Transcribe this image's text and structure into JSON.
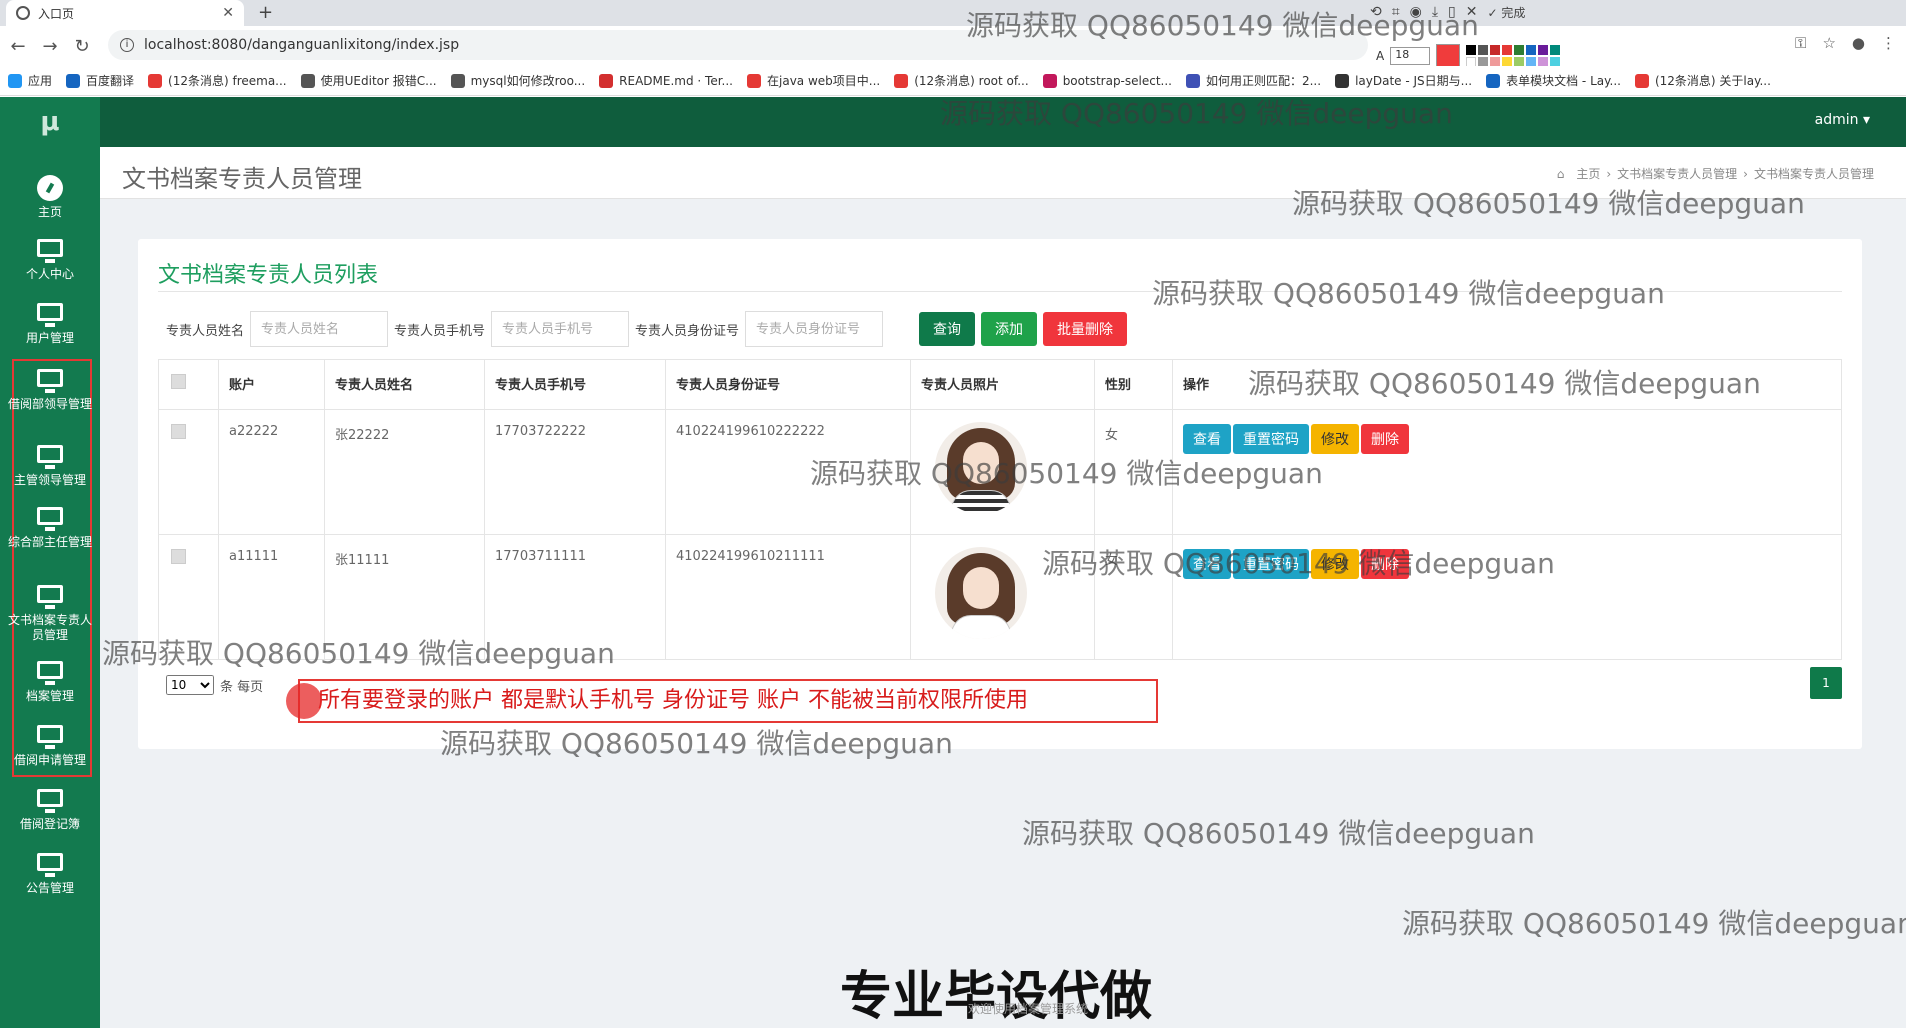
{
  "browser": {
    "tab_title": "入口页",
    "url": "localhost:8080/danganguanlixitong/index.jsp",
    "font_size": "18",
    "done_label": "完成",
    "bookmarks": [
      "应用",
      "百度翻译",
      "(12条消息) freema...",
      "使用UEditor 报错C...",
      "mysql如何修改roo...",
      "README.md · Ter...",
      "在java web项目中...",
      "(12条消息) root of...",
      "bootstrap-select...",
      "如何用正则匹配：2...",
      "layDate - JS日期与...",
      "表单模块文档 - Lay...",
      "(12条消息) 关于lay..."
    ]
  },
  "app": {
    "logo": "μ",
    "user": "admin",
    "sidebar": [
      "主页",
      "个人中心",
      "用户管理",
      "借阅部领导管理",
      "主管领导管理",
      "综合部主任管理",
      "文书档案专责人员管理",
      "档案管理",
      "借阅申请管理",
      "借阅登记簿",
      "公告管理"
    ]
  },
  "page": {
    "title": "文书档案专责人员管理",
    "breadcrumb": [
      "主页",
      "文书档案专责人员管理",
      "文书档案专责人员管理"
    ],
    "list_title": "文书档案专责人员列表"
  },
  "search": {
    "name_label": "专责人员姓名",
    "name_placeholder": "专责人员姓名",
    "phone_label": "专责人员手机号",
    "phone_placeholder": "专责人员手机号",
    "idcard_label": "专责人员身份证号",
    "idcard_placeholder": "专责人员身份证号",
    "query_btn": "查询",
    "add_btn": "添加",
    "batch_delete_btn": "批量删除"
  },
  "table": {
    "headers": [
      "账户",
      "专责人员姓名",
      "专责人员手机号",
      "专责人员身份证号",
      "专责人员照片",
      "性别",
      "操作"
    ],
    "rows": [
      {
        "account": "a22222",
        "name": "张22222",
        "phone": "17703722222",
        "idcard": "410224199610222222",
        "gender": "女"
      },
      {
        "account": "a11111",
        "name": "张11111",
        "phone": "17703711111",
        "idcard": "410224199610211111",
        "gender": "女"
      }
    ],
    "actions": {
      "view": "查看",
      "reset": "重置密码",
      "edit": "修改",
      "delete": "删除"
    }
  },
  "pager": {
    "page_size": "10",
    "per_page_label": "条 每页",
    "current_page": "1"
  },
  "annotation": "所有要登录的账户 都是默认手机号 身份证号  账户  不能被当前权限所使用",
  "watermark": "源码获取 QQ86050149 微信deepguan",
  "promo": "专业毕设代做",
  "footer_faint": "欢迎使用档案管理系统"
}
